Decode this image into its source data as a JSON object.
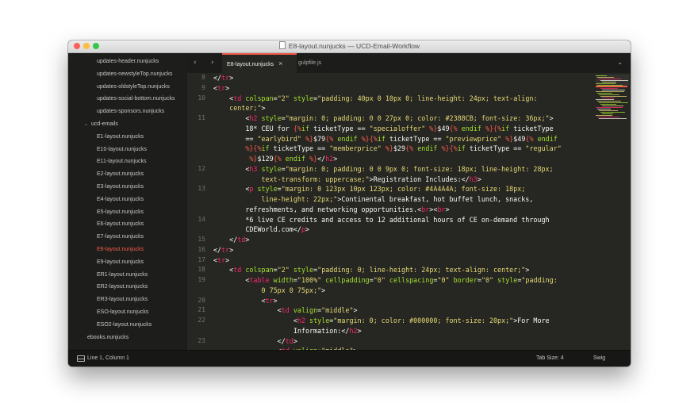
{
  "window": {
    "title": "E8-layout.nunjucks — UCD-Email-Workflow"
  },
  "sidebar": {
    "items": [
      {
        "label": "updates-header.nunjucks"
      },
      {
        "label": "updates-newstyleTop.nunjucks"
      },
      {
        "label": "updates-oldstyleTop.nunjucks"
      },
      {
        "label": "updates-social-bottom.nunjucks"
      },
      {
        "label": "updates-sponsors.nunjucks"
      },
      {
        "label": "ucd-emails",
        "folder": true
      },
      {
        "label": "E1-layout.nunjucks"
      },
      {
        "label": "E10-layout.nunjucks"
      },
      {
        "label": "E11-layout.nunjucks"
      },
      {
        "label": "E2-layout.nunjucks"
      },
      {
        "label": "E3-layout.nunjucks"
      },
      {
        "label": "E4-layout.nunjucks"
      },
      {
        "label": "E5-layout.nunjucks"
      },
      {
        "label": "E6-layout.nunjucks"
      },
      {
        "label": "E7-layout.nunjucks"
      },
      {
        "label": "E8-layout.nunjucks",
        "active": true
      },
      {
        "label": "E9-layout.nunjucks"
      },
      {
        "label": "ER1-layout.nunjucks"
      },
      {
        "label": "ER2-layout.nunjucks"
      },
      {
        "label": "ER3-layout.nunjucks"
      },
      {
        "label": "ESO-layout.nunjucks"
      },
      {
        "label": "ESO2-layout.nunjucks"
      },
      {
        "label": "ebooks.nunjucks"
      }
    ]
  },
  "tabs": [
    {
      "label": "E8-layout.nunjucks",
      "active": true
    },
    {
      "label": "gulpfile.js"
    }
  ],
  "icons": {
    "back": "‹",
    "forward": "›",
    "close": "×",
    "menu": "⌄",
    "folder_chevron": "⌄"
  },
  "line_numbers": [
    "8",
    "9",
    "10",
    "",
    "11",
    "",
    "",
    "",
    "",
    "12",
    "",
    "13",
    "",
    "",
    "14",
    "",
    "15",
    "16",
    "17",
    "18",
    "19",
    "",
    "20",
    "21",
    "22",
    "",
    "23"
  ],
  "code_lines": [
    [
      {
        "t": "</",
        "c": "op"
      },
      {
        "t": "tr",
        "c": "tg"
      },
      {
        "t": ">",
        "c": "op"
      }
    ],
    [
      {
        "t": "<",
        "c": "op"
      },
      {
        "t": "tr",
        "c": "tg"
      },
      {
        "t": ">",
        "c": "op"
      }
    ],
    [
      {
        "t": "    <",
        "c": "op"
      },
      {
        "t": "td",
        "c": "tg"
      },
      {
        "t": " colspan",
        "c": "at"
      },
      {
        "t": "=",
        "c": "op"
      },
      {
        "t": "\"2\"",
        "c": "st"
      },
      {
        "t": " style",
        "c": "at"
      },
      {
        "t": "=",
        "c": "op"
      },
      {
        "t": "\"padding: 40px 0 10px 0; line-height: 24px; text-align:",
        "c": "st"
      }
    ],
    [
      {
        "t": "    center;\"",
        "c": "st"
      },
      {
        "t": ">",
        "c": "op"
      }
    ],
    [
      {
        "t": "        <",
        "c": "op"
      },
      {
        "t": "h2",
        "c": "tg"
      },
      {
        "t": " style",
        "c": "at"
      },
      {
        "t": "=",
        "c": "op"
      },
      {
        "t": "\"margin: 0; padding: 0 0 27px 0; color: #2388CB; font-size: 36px;\"",
        "c": "st"
      },
      {
        "t": ">",
        "c": "op"
      }
    ],
    [
      {
        "t": "        18* CEU for ",
        "c": "op"
      },
      {
        "t": "{%",
        "c": "tm"
      },
      {
        "t": "if ",
        "c": "at"
      },
      {
        "t": "ticketType",
        "c": "op"
      },
      {
        "t": " == ",
        "c": "op"
      },
      {
        "t": "\"specialoffer\"",
        "c": "st"
      },
      {
        "t": " %}",
        "c": "tm"
      },
      {
        "t": "$49",
        "c": "op"
      },
      {
        "t": "{% ",
        "c": "tm"
      },
      {
        "t": "endif",
        "c": "at"
      },
      {
        "t": " %}",
        "c": "tm"
      },
      {
        "t": "{%",
        "c": "tm"
      },
      {
        "t": "if ",
        "c": "at"
      },
      {
        "t": "ticketType",
        "c": "op"
      }
    ],
    [
      {
        "t": "        == ",
        "c": "op"
      },
      {
        "t": "\"earlybird\"",
        "c": "st"
      },
      {
        "t": " %}",
        "c": "tm"
      },
      {
        "t": "$79",
        "c": "op"
      },
      {
        "t": "{% ",
        "c": "tm"
      },
      {
        "t": "endif",
        "c": "at"
      },
      {
        "t": " %}",
        "c": "tm"
      },
      {
        "t": "{%",
        "c": "tm"
      },
      {
        "t": "if ",
        "c": "at"
      },
      {
        "t": "ticketType",
        "c": "op"
      },
      {
        "t": " == ",
        "c": "op"
      },
      {
        "t": "\"previewprice\"",
        "c": "st"
      },
      {
        "t": " %}",
        "c": "tm"
      },
      {
        "t": "$49",
        "c": "op"
      },
      {
        "t": "{% ",
        "c": "tm"
      },
      {
        "t": "endif",
        "c": "at"
      }
    ],
    [
      {
        "t": "        %}",
        "c": "tm"
      },
      {
        "t": "{%",
        "c": "tm"
      },
      {
        "t": "if ",
        "c": "at"
      },
      {
        "t": "ticketType",
        "c": "op"
      },
      {
        "t": " == ",
        "c": "op"
      },
      {
        "t": "\"memberprice\"",
        "c": "st"
      },
      {
        "t": " %}",
        "c": "tm"
      },
      {
        "t": "$29",
        "c": "op"
      },
      {
        "t": "{% ",
        "c": "tm"
      },
      {
        "t": "endif",
        "c": "at"
      },
      {
        "t": " %}",
        "c": "tm"
      },
      {
        "t": "{%",
        "c": "tm"
      },
      {
        "t": "if ",
        "c": "at"
      },
      {
        "t": "ticketType",
        "c": "op"
      },
      {
        "t": " == ",
        "c": "op"
      },
      {
        "t": "\"regular\"",
        "c": "st"
      }
    ],
    [
      {
        "t": "         %}",
        "c": "tm"
      },
      {
        "t": "$129",
        "c": "op"
      },
      {
        "t": "{% ",
        "c": "tm"
      },
      {
        "t": "endif",
        "c": "at"
      },
      {
        "t": " %}",
        "c": "tm"
      },
      {
        "t": "</",
        "c": "op"
      },
      {
        "t": "h2",
        "c": "tg"
      },
      {
        "t": ">",
        "c": "op"
      }
    ],
    [
      {
        "t": "        <",
        "c": "op"
      },
      {
        "t": "h3",
        "c": "tg"
      },
      {
        "t": " style",
        "c": "at"
      },
      {
        "t": "=",
        "c": "op"
      },
      {
        "t": "\"margin: 0; padding: 0 0 9px 0; font-size: 18px; line-height: 28px;",
        "c": "st"
      }
    ],
    [
      {
        "t": "            text-transform: uppercase;\"",
        "c": "st"
      },
      {
        "t": ">Registration Includes:</",
        "c": "op"
      },
      {
        "t": "h3",
        "c": "tg"
      },
      {
        "t": ">",
        "c": "op"
      }
    ],
    [
      {
        "t": "        <",
        "c": "op"
      },
      {
        "t": "p",
        "c": "tg"
      },
      {
        "t": " style",
        "c": "at"
      },
      {
        "t": "=",
        "c": "op"
      },
      {
        "t": "\"margin: 0 123px 10px 123px; color: #4A4A4A; font-size: 18px;",
        "c": "st"
      }
    ],
    [
      {
        "t": "            line-height: 22px;\"",
        "c": "st"
      },
      {
        "t": ">Continental breakfast, hot buffet lunch, snacks,",
        "c": "op"
      }
    ],
    [
      {
        "t": "        refreshments, and networking opportunities.<",
        "c": "op"
      },
      {
        "t": "br",
        "c": "tg"
      },
      {
        "t": "><",
        "c": "op"
      },
      {
        "t": "br",
        "c": "tg"
      },
      {
        "t": ">",
        "c": "op"
      }
    ],
    [
      {
        "t": "        *6 live CE credits and access to 12 additional hours of CE on-demand through",
        "c": "op"
      }
    ],
    [
      {
        "t": "        CDEWorld.com</",
        "c": "op"
      },
      {
        "t": "p",
        "c": "tg"
      },
      {
        "t": ">",
        "c": "op"
      }
    ],
    [
      {
        "t": "    </",
        "c": "op"
      },
      {
        "t": "td",
        "c": "tg"
      },
      {
        "t": ">",
        "c": "op"
      }
    ],
    [
      {
        "t": "</",
        "c": "op"
      },
      {
        "t": "tr",
        "c": "tg"
      },
      {
        "t": ">",
        "c": "op"
      }
    ],
    [
      {
        "t": "<",
        "c": "op"
      },
      {
        "t": "tr",
        "c": "tg"
      },
      {
        "t": ">",
        "c": "op"
      }
    ],
    [
      {
        "t": "    <",
        "c": "op"
      },
      {
        "t": "td",
        "c": "tg"
      },
      {
        "t": " colspan",
        "c": "at"
      },
      {
        "t": "=",
        "c": "op"
      },
      {
        "t": "\"2\"",
        "c": "st"
      },
      {
        "t": " style",
        "c": "at"
      },
      {
        "t": "=",
        "c": "op"
      },
      {
        "t": "\"padding: 0; line-height: 24px; text-align: center;\"",
        "c": "st"
      },
      {
        "t": ">",
        "c": "op"
      }
    ],
    [
      {
        "t": "        <",
        "c": "op"
      },
      {
        "t": "table",
        "c": "tg"
      },
      {
        "t": " width",
        "c": "at"
      },
      {
        "t": "=",
        "c": "op"
      },
      {
        "t": "\"100%\"",
        "c": "st"
      },
      {
        "t": " cellpadding",
        "c": "at"
      },
      {
        "t": "=",
        "c": "op"
      },
      {
        "t": "\"0\"",
        "c": "st"
      },
      {
        "t": " cellspacing",
        "c": "at"
      },
      {
        "t": "=",
        "c": "op"
      },
      {
        "t": "\"0\"",
        "c": "st"
      },
      {
        "t": " border",
        "c": "at"
      },
      {
        "t": "=",
        "c": "op"
      },
      {
        "t": "\"0\"",
        "c": "st"
      },
      {
        "t": " style",
        "c": "at"
      },
      {
        "t": "=",
        "c": "op"
      },
      {
        "t": "\"padding:",
        "c": "st"
      }
    ],
    [
      {
        "t": "            0 75px 0 75px;\"",
        "c": "st"
      },
      {
        "t": ">",
        "c": "op"
      }
    ],
    [
      {
        "t": "            <",
        "c": "op"
      },
      {
        "t": "tr",
        "c": "tg"
      },
      {
        "t": ">",
        "c": "op"
      }
    ],
    [
      {
        "t": "                <",
        "c": "op"
      },
      {
        "t": "td",
        "c": "tg"
      },
      {
        "t": " valign",
        "c": "at"
      },
      {
        "t": "=",
        "c": "op"
      },
      {
        "t": "\"middle\"",
        "c": "st"
      },
      {
        "t": ">",
        "c": "op"
      }
    ],
    [
      {
        "t": "                    <",
        "c": "op"
      },
      {
        "t": "h2",
        "c": "tg"
      },
      {
        "t": " style",
        "c": "at"
      },
      {
        "t": "=",
        "c": "op"
      },
      {
        "t": "\"margin: 0; color: #000000; font-size: 20px;\"",
        "c": "st"
      },
      {
        "t": ">For More",
        "c": "op"
      }
    ],
    [
      {
        "t": "                    Information:</",
        "c": "op"
      },
      {
        "t": "h2",
        "c": "tg"
      },
      {
        "t": ">",
        "c": "op"
      }
    ],
    [
      {
        "t": "                </",
        "c": "op"
      },
      {
        "t": "td",
        "c": "tg"
      },
      {
        "t": ">",
        "c": "op"
      }
    ],
    [
      {
        "t": "                <",
        "c": "op"
      },
      {
        "t": "td",
        "c": "tg"
      },
      {
        "t": " valign",
        "c": "at"
      },
      {
        "t": "=",
        "c": "op"
      },
      {
        "t": "\"middle\"",
        "c": "st"
      },
      {
        "t": ">",
        "c": "op"
      }
    ]
  ],
  "status": {
    "cursor": "Line 1, Column 1",
    "tab_size": "Tab Size: 4",
    "syntax": "Swig"
  },
  "colors": {
    "accent": "#f35b4a",
    "background": "#262623",
    "tag": "#f92672",
    "attribute": "#a6e22e",
    "string": "#e6db74"
  }
}
